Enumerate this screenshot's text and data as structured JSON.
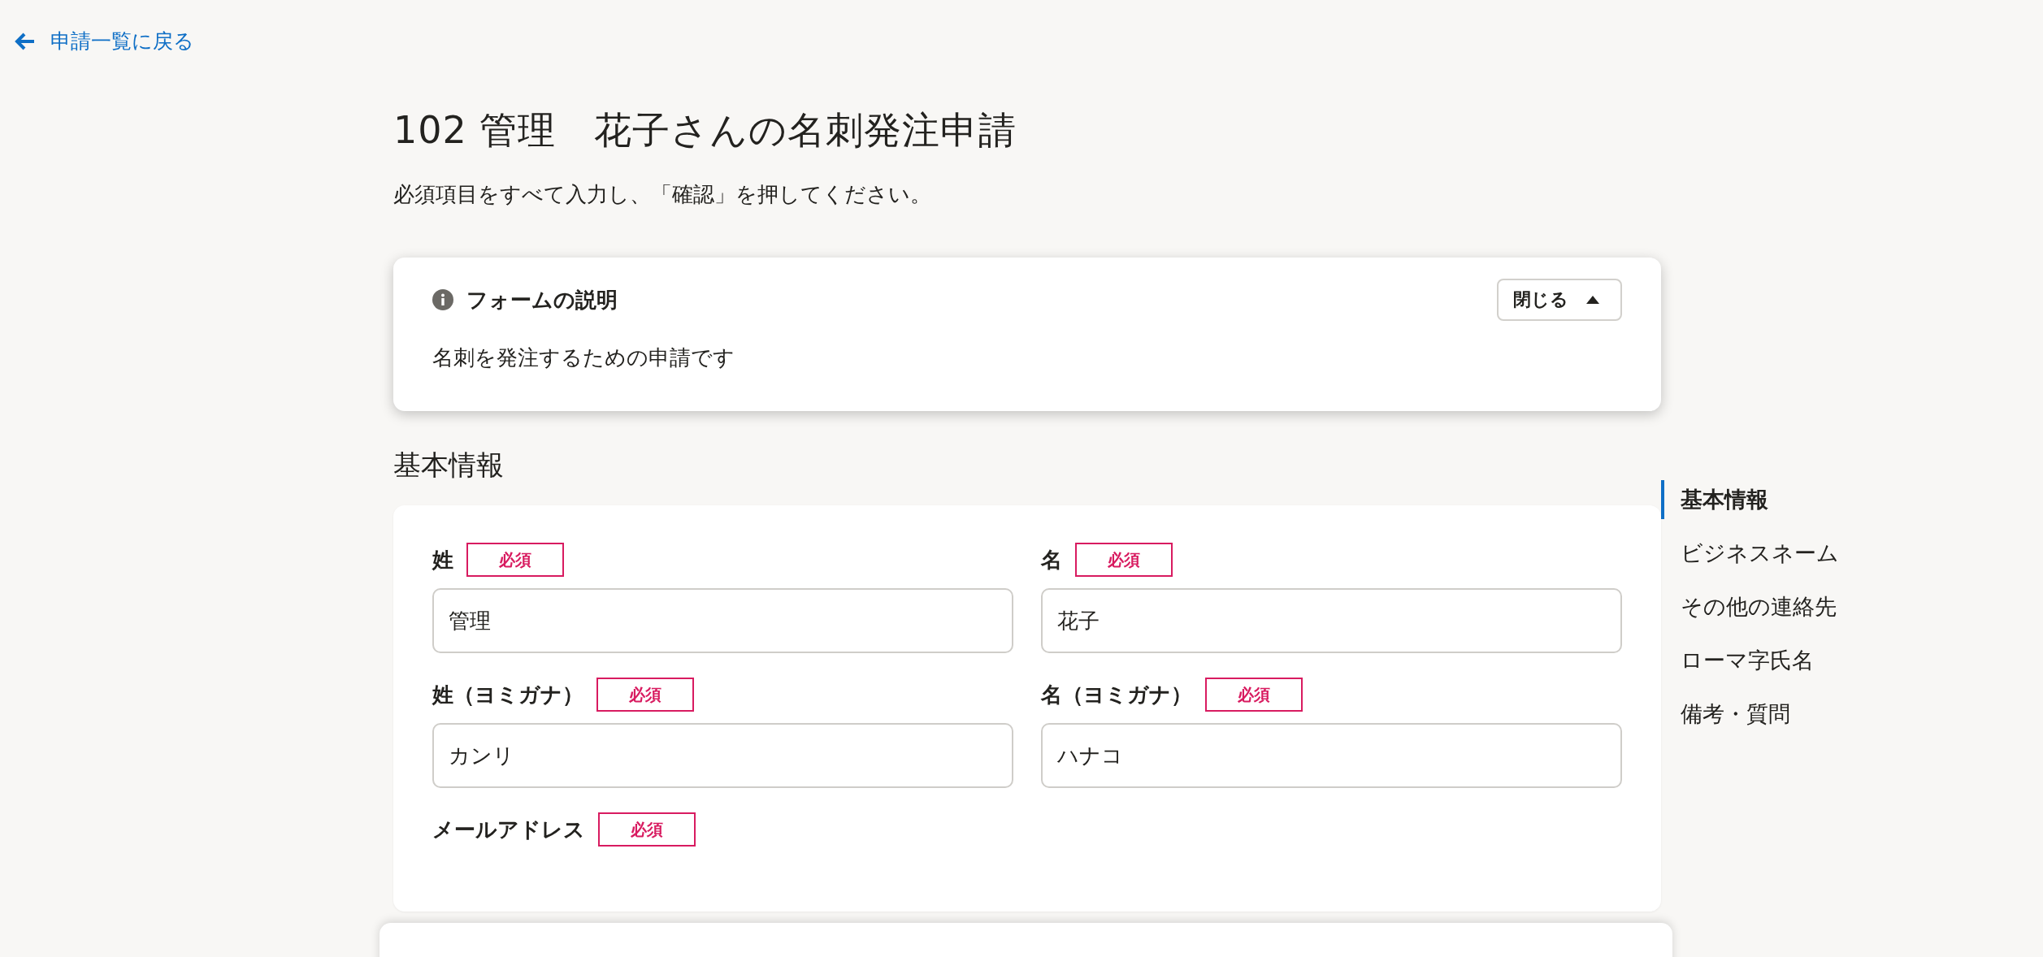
{
  "back_link": {
    "label": "申請一覧に戻る"
  },
  "page": {
    "title": "102 管理　花子さんの名刺発注申請",
    "subtitle": "必須項目をすべて入力し、「確認」を押してください。"
  },
  "description_card": {
    "title": "フォームの説明",
    "expanded": true,
    "toggle_label": "閉じる",
    "body": "名刺を発注するための申請です"
  },
  "section": {
    "heading": "基本情報",
    "fields": [
      {
        "label": "姓",
        "badge": "必須",
        "value": "管理"
      },
      {
        "label": "名",
        "badge": "必須",
        "value": "花子"
      },
      {
        "label": "姓（ヨミガナ）",
        "badge": "必須",
        "value": "カンリ"
      },
      {
        "label": "名（ヨミガナ）",
        "badge": "必須",
        "value": "ハナコ"
      },
      {
        "label": "メールアドレス",
        "badge": "必須"
      }
    ]
  },
  "side_nav": [
    {
      "label": "基本情報",
      "selected": true
    },
    {
      "label": "ビジネスネーム",
      "selected": false
    },
    {
      "label": "その他の連絡先",
      "selected": false
    },
    {
      "label": "ローマ字氏名",
      "selected": false
    },
    {
      "label": "備考・質問",
      "selected": false
    }
  ]
}
